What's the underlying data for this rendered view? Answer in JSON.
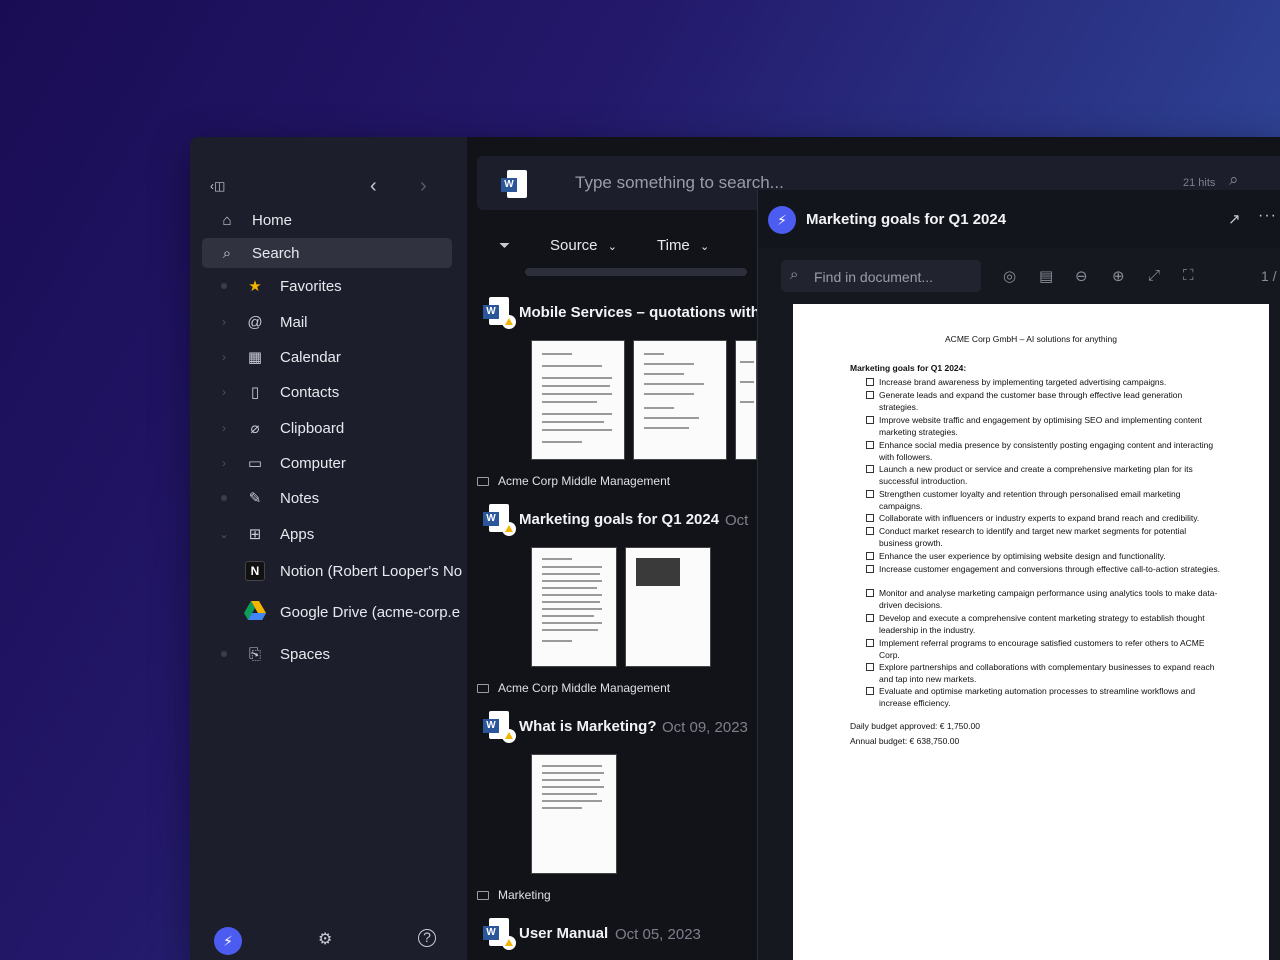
{
  "sidebar": {
    "nav": [
      {
        "label": "Home",
        "icon": "home-icon"
      },
      {
        "label": "Search",
        "icon": "search-icon",
        "active": true
      }
    ],
    "items": [
      {
        "label": "Favorites",
        "icon": "star-icon"
      },
      {
        "label": "Mail",
        "icon": "at-icon"
      },
      {
        "label": "Calendar",
        "icon": "calendar-icon"
      },
      {
        "label": "Contacts",
        "icon": "contacts-icon"
      },
      {
        "label": "Clipboard",
        "icon": "paperclip-icon"
      },
      {
        "label": "Computer",
        "icon": "folder-icon"
      },
      {
        "label": "Notes",
        "icon": "edit-icon"
      },
      {
        "label": "Apps",
        "icon": "apps-icon"
      },
      {
        "label": "Notion (Robert Looper's No",
        "icon": "notion-icon"
      },
      {
        "label": "Google Drive (acme-corp.e",
        "icon": "google-drive-icon"
      },
      {
        "label": "Spaces",
        "icon": "bookmark-icon"
      }
    ]
  },
  "search": {
    "placeholder": "Type something to search...",
    "hits": "21 hits"
  },
  "filters": {
    "source": "Source",
    "time": "Time"
  },
  "results": [
    {
      "title": "Mobile Services – quotations with",
      "date": "",
      "folder": "Acme Corp Middle Management"
    },
    {
      "title": "Marketing goals for Q1 2024",
      "date": "Oct",
      "folder": "Acme Corp Middle Management"
    },
    {
      "title": "What is Marketing?",
      "date": "Oct 09, 2023",
      "folder": "Marketing"
    },
    {
      "title": "User Manual",
      "date": "Oct 05, 2023",
      "folder": ""
    }
  ],
  "preview": {
    "title": "Marketing goals for Q1 2024",
    "find_placeholder": "Find in document...",
    "page_indicator": "1 /",
    "doc": {
      "header": "ACME Corp GmbH – AI solutions for anything",
      "heading": "Marketing goals for Q1 2024:",
      "items": [
        "Increase brand awareness by implementing targeted advertising campaigns.",
        "Generate leads and expand the customer base through effective lead generation strategies.",
        "Improve website traffic and engagement by optimising SEO and implementing content marketing strategies.",
        "Enhance social media presence by consistently posting engaging content and interacting with followers.",
        "Launch a new product or service and create a comprehensive marketing plan for its successful introduction.",
        "Strengthen customer loyalty and retention through personalised email marketing campaigns.",
        "Collaborate with influencers or industry experts to expand brand reach and credibility.",
        "Conduct market research to identify and target new market segments for potential business growth.",
        "Enhance the user experience by optimising website design and functionality.",
        "Increase customer engagement and conversions through effective call-to-action strategies.",
        "Monitor and analyse marketing campaign performance using analytics tools to make data-driven decisions.",
        "Develop and execute a comprehensive content marketing strategy to establish thought leadership in the industry.",
        "Implement referral programs to encourage satisfied customers to refer others to ACME Corp.",
        "Explore partnerships and collaborations with complementary businesses to expand reach and tap into new markets.",
        "Evaluate and optimise marketing automation processes to streamline workflows and increase efficiency."
      ],
      "daily_budget": "Daily budget approved: € 1,750.00",
      "annual_budget": "Annual budget: € 638,750.00"
    }
  },
  "colors": {
    "accent": "#4d5cf0",
    "sidebar_bg": "#1c1f2b",
    "panel_bg": "#111319"
  }
}
